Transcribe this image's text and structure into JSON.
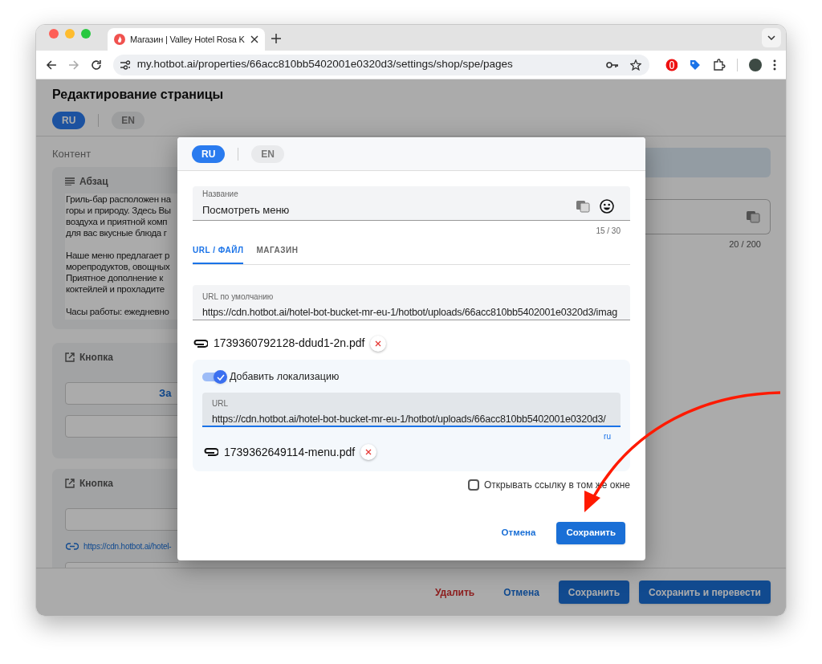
{
  "browser": {
    "tab": {
      "title": "Магазин | Valley Hotel Rosa K"
    },
    "url": "my.hotbot.ai/properties/66acc810bb5402001e0320d3/settings/shop/spe/pages"
  },
  "page": {
    "title": "Редактирование страницы",
    "languages": [
      {
        "label": "RU",
        "selected": true
      },
      {
        "label": "EN",
        "selected": false
      }
    ],
    "section_label": "Контент",
    "blocks": [
      {
        "kind": "paragraph",
        "title": "Абзац",
        "paragraphs": [
          [
            "Гриль-бар расположен на",
            "горы и природу. Здесь Вы",
            "воздуха и приятной комп",
            "для вас вкусные блюда г"
          ],
          [
            "Наше меню предлагает р",
            "морепродуктов, овощных",
            "Приятное дополнение к",
            "коктейлей и прохладите"
          ],
          [
            "Часы работы: ежедневно"
          ]
        ]
      },
      {
        "kind": "button",
        "title": "Кнопка",
        "rows": [
          {
            "kind": "action",
            "label": "За"
          },
          {
            "kind": "field"
          }
        ]
      },
      {
        "kind": "button",
        "title": "Кнопка",
        "rows": [
          {
            "kind": "field"
          },
          {
            "kind": "link",
            "label": "https://cdn.hotbot.ai/hotel-"
          },
          {
            "kind": "field"
          }
        ]
      }
    ],
    "side_counter": "20 / 200",
    "footer_buttons": [
      {
        "label": "Удалить",
        "kind": "danger"
      },
      {
        "label": "Отмена",
        "kind": "text"
      },
      {
        "label": "Сохранить",
        "kind": "primary"
      },
      {
        "label": "Сохранить и перевести",
        "kind": "primary"
      }
    ]
  },
  "dialog": {
    "languages": [
      {
        "label": "RU",
        "selected": true
      },
      {
        "label": "EN",
        "selected": false
      }
    ],
    "name_field": {
      "label": "Название",
      "value": "Посмотреть меню",
      "counter": "15 / 30"
    },
    "tabs": [
      {
        "label": "URL / ФАЙЛ",
        "selected": true
      },
      {
        "label": "МАГАЗИН",
        "selected": false
      }
    ],
    "default_url": {
      "label": "URL по умолчанию",
      "value": "https://cdn.hotbot.ai/hotel-bot-bucket-mr-eu-1/hotbot/uploads/66acc810bb5402001e0320d3/imag"
    },
    "file": "1739360792128-ddud1-2n.pdf",
    "localization": {
      "label": "Добавить локализацию",
      "on": true,
      "url_label": "URL",
      "url_value": "https://cdn.hotbot.ai/hotel-bot-bucket-mr-eu-1/hotbot/uploads/66acc810bb5402001e0320d3/",
      "locale": "ru",
      "file": "1739362649114-menu.pdf"
    },
    "same_window": {
      "label": "Открывать ссылку в том же окне",
      "checked": false
    },
    "buttons": [
      {
        "label": "Отмена",
        "kind": "text"
      },
      {
        "label": "Сохранить",
        "kind": "primary"
      }
    ]
  }
}
